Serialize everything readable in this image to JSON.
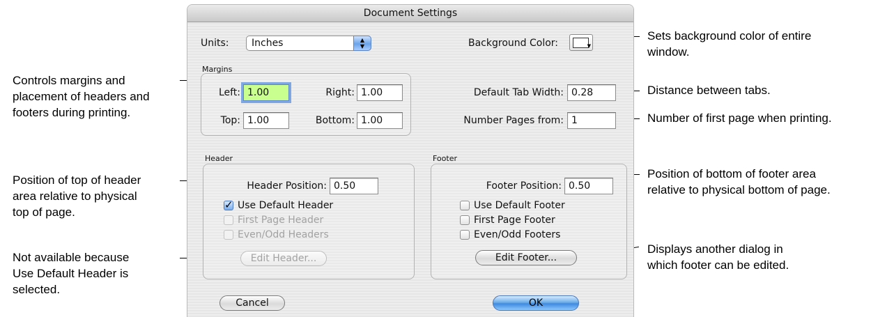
{
  "dialog": {
    "title": "Document Settings",
    "units": {
      "label": "Units:",
      "value": "Inches"
    },
    "background_color": {
      "label": "Background Color:",
      "value": "#ffffff"
    },
    "margins": {
      "label": "Margins",
      "left": {
        "label": "Left:",
        "value": "1.00"
      },
      "right": {
        "label": "Right:",
        "value": "1.00"
      },
      "top": {
        "label": "Top:",
        "value": "1.00"
      },
      "bottom": {
        "label": "Bottom:",
        "value": "1.00"
      }
    },
    "default_tab_width": {
      "label": "Default Tab Width:",
      "value": "0.28"
    },
    "number_pages_from": {
      "label": "Number Pages from:",
      "value": "1"
    },
    "header": {
      "label": "Header",
      "position": {
        "label": "Header Position:",
        "value": "0.50"
      },
      "use_default": {
        "label": "Use Default Header",
        "checked": true,
        "enabled": true
      },
      "first_page": {
        "label": "First Page Header",
        "checked": false,
        "enabled": false
      },
      "even_odd": {
        "label": "Even/Odd Headers",
        "checked": false,
        "enabled": false
      },
      "edit_button": {
        "label": "Edit Header...",
        "enabled": false
      }
    },
    "footer": {
      "label": "Footer",
      "position": {
        "label": "Footer Position:",
        "value": "0.50"
      },
      "use_default": {
        "label": "Use Default Footer",
        "checked": false,
        "enabled": true
      },
      "first_page": {
        "label": "First Page Footer",
        "checked": false,
        "enabled": true
      },
      "even_odd": {
        "label": "Even/Odd Footers",
        "checked": false,
        "enabled": true
      },
      "edit_button": {
        "label": "Edit Footer...",
        "enabled": true
      }
    },
    "cancel_label": "Cancel",
    "ok_label": "OK"
  },
  "callouts": {
    "margins": [
      "Controls margins and",
      "placement of headers and",
      "footers during printing."
    ],
    "header_position": [
      "Position of top of header",
      "area relative to physical",
      "top of page."
    ],
    "not_available": [
      "Not available because",
      "Use Default Header is",
      "selected."
    ],
    "background": [
      "Sets background color of entire",
      "window."
    ],
    "tabs": [
      "Distance between tabs."
    ],
    "first_page": [
      "Number of first page when printing."
    ],
    "footer_position": [
      "Position of bottom of footer area",
      "relative to physical bottom of page."
    ],
    "edit_footer": [
      "Displays another dialog in",
      "which footer can be edited."
    ]
  }
}
